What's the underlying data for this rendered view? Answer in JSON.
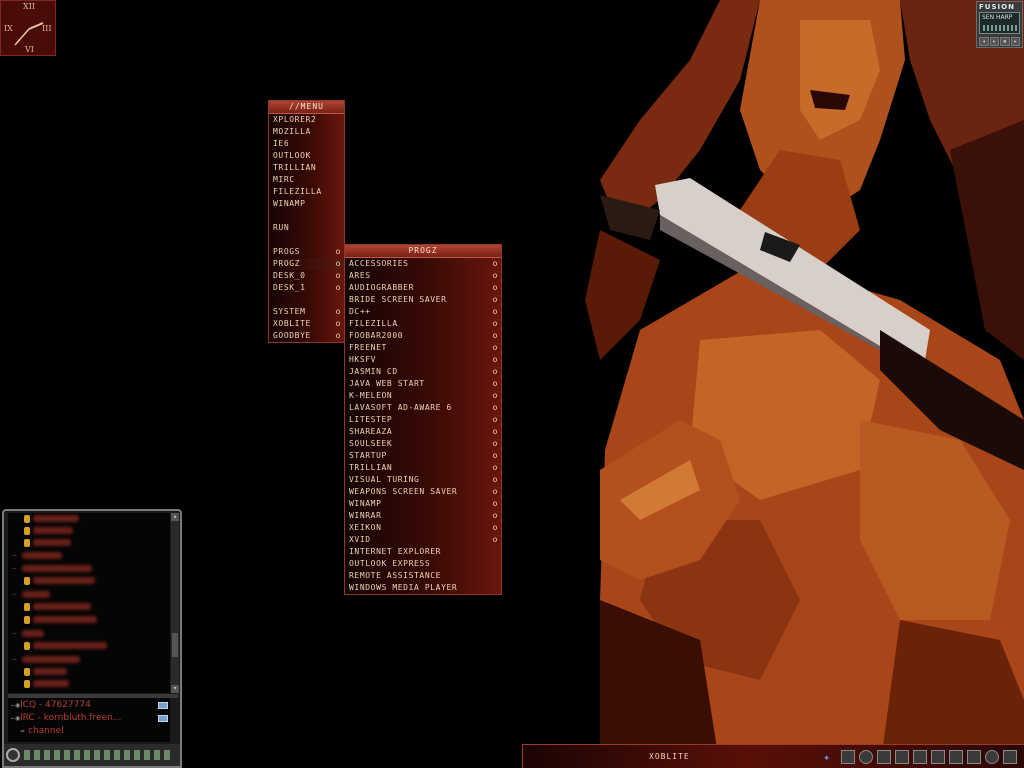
{
  "clock": {
    "numerals": [
      "XII",
      "III",
      "VI",
      "IX"
    ]
  },
  "fusion": {
    "title": "FUSION",
    "track": "SEN HARP"
  },
  "menu": {
    "title": "//MENU",
    "items": [
      "XPLORER2",
      "MOZILLA",
      "IE6",
      "OUTLOOK",
      "TRILLIAN",
      "MIRC",
      "FILEZILLA",
      "WINAMP"
    ],
    "run": "RUN",
    "submenus": [
      "PROGS",
      "PROGZ",
      "DESK_0",
      "DESK_1"
    ],
    "system": [
      "SYSTEM",
      "XOBLITE",
      "GOODBYE"
    ],
    "arrow": "o"
  },
  "progz_menu": {
    "title": "PROGZ",
    "folders": [
      "ACCESSORIES",
      "ARES",
      "AUDIOGRABBER",
      "BRIDE SCREEN SAVER",
      "DC++",
      "FILEZILLA",
      "FOOBAR2000",
      "FREENET",
      "HKSFV",
      "JASMIN CD",
      "JAVA WEB START",
      "K-MELEON",
      "LAVASOFT AD-AWARE 6",
      "LITESTEP",
      "SHAREAZA",
      "SOULSEEK",
      "STARTUP",
      "TRILLIAN",
      "VISUAL TURING",
      "WEAPONS SCREEN SAVER",
      "WINAMP",
      "WINRAR",
      "XEIKON",
      "XVID"
    ],
    "shortcuts": [
      "INTERNET EXPLORER",
      "OUTLOOK EXPRESS",
      "REMOTE ASSISTANCE",
      "WINDOWS MEDIA PLAYER"
    ]
  },
  "trillian": {
    "status_rows": [
      "ICQ - 47627774",
      "IRC - kornbluth.freen...",
      "channel"
    ]
  },
  "taskbar": {
    "label": "XOBLITE"
  },
  "colors": {
    "menu_header": "#9a3424",
    "menu_text": "#f0d2b4",
    "taskbar": "#5a1008",
    "trillian_text": "#b84030"
  }
}
